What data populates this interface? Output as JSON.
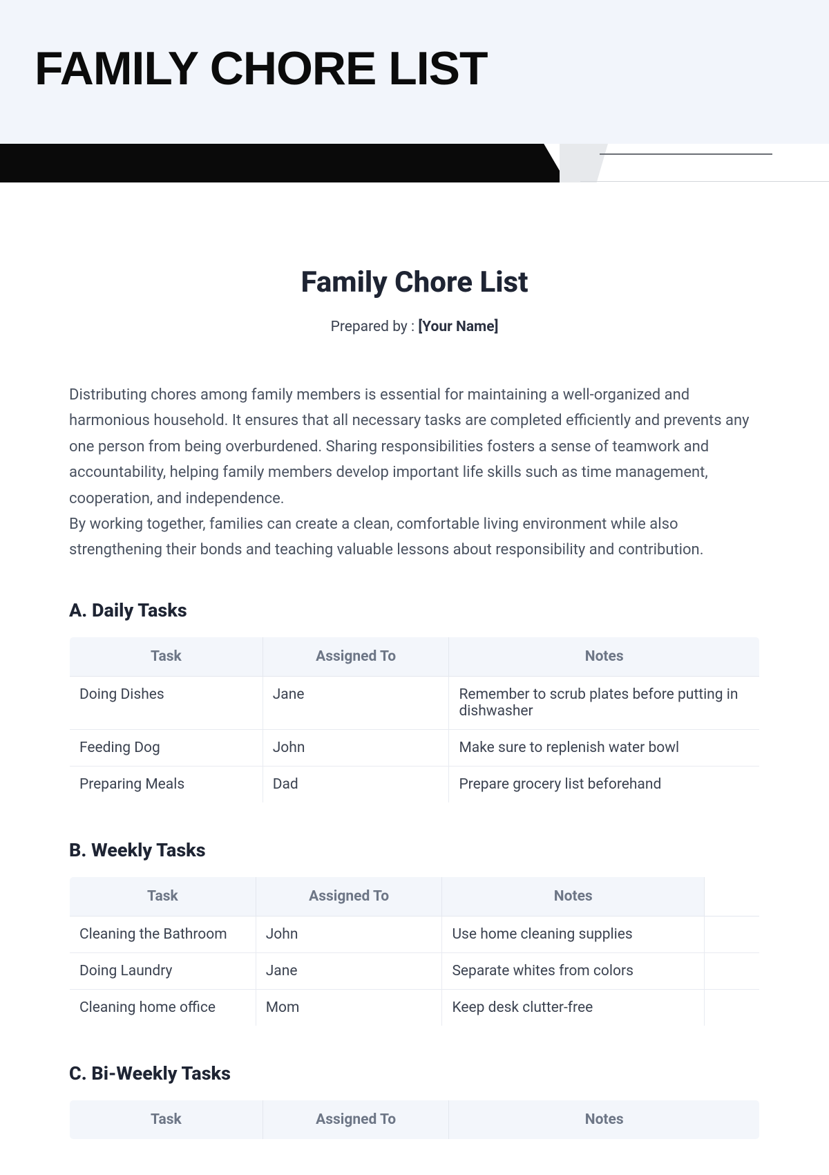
{
  "hero": {
    "title": "FAMILY CHORE LIST"
  },
  "doc": {
    "title": "Family Chore List",
    "prepared_label": "Prepared by : ",
    "prepared_name": "[Your Name]"
  },
  "intro": {
    "p1": "Distributing chores among family members is essential for maintaining a well-organized and harmonious household. It ensures that all necessary tasks are completed efficiently and prevents any one person from being overburdened. Sharing responsibilities fosters a sense of teamwork and accountability, helping family members develop important life skills such as time management, cooperation, and independence.",
    "p2": "By working together, families can create a clean, comfortable living environment while also strengthening their bonds and teaching valuable lessons about responsibility and contribution."
  },
  "columns": {
    "task": "Task",
    "assigned": "Assigned To",
    "notes": "Notes"
  },
  "sections": {
    "daily": {
      "heading": "A. Daily Tasks",
      "rows": [
        {
          "task": "Doing Dishes",
          "assigned": "Jane",
          "notes": "Remember to scrub plates before putting in dishwasher"
        },
        {
          "task": "Feeding Dog",
          "assigned": "John",
          "notes": "Make sure to replenish water bowl"
        },
        {
          "task": "Preparing Meals",
          "assigned": "Dad",
          "notes": "Prepare grocery list beforehand"
        }
      ]
    },
    "weekly": {
      "heading": "B. Weekly Tasks",
      "rows": [
        {
          "task": "Cleaning the Bathroom",
          "assigned": "John",
          "notes": "Use home cleaning supplies"
        },
        {
          "task": "Doing Laundry",
          "assigned": "Jane",
          "notes": "Separate whites from colors"
        },
        {
          "task": "Cleaning home office",
          "assigned": "Mom",
          "notes": "Keep desk clutter-free"
        }
      ]
    },
    "biweekly": {
      "heading": "C. Bi-Weekly Tasks",
      "rows": []
    }
  }
}
